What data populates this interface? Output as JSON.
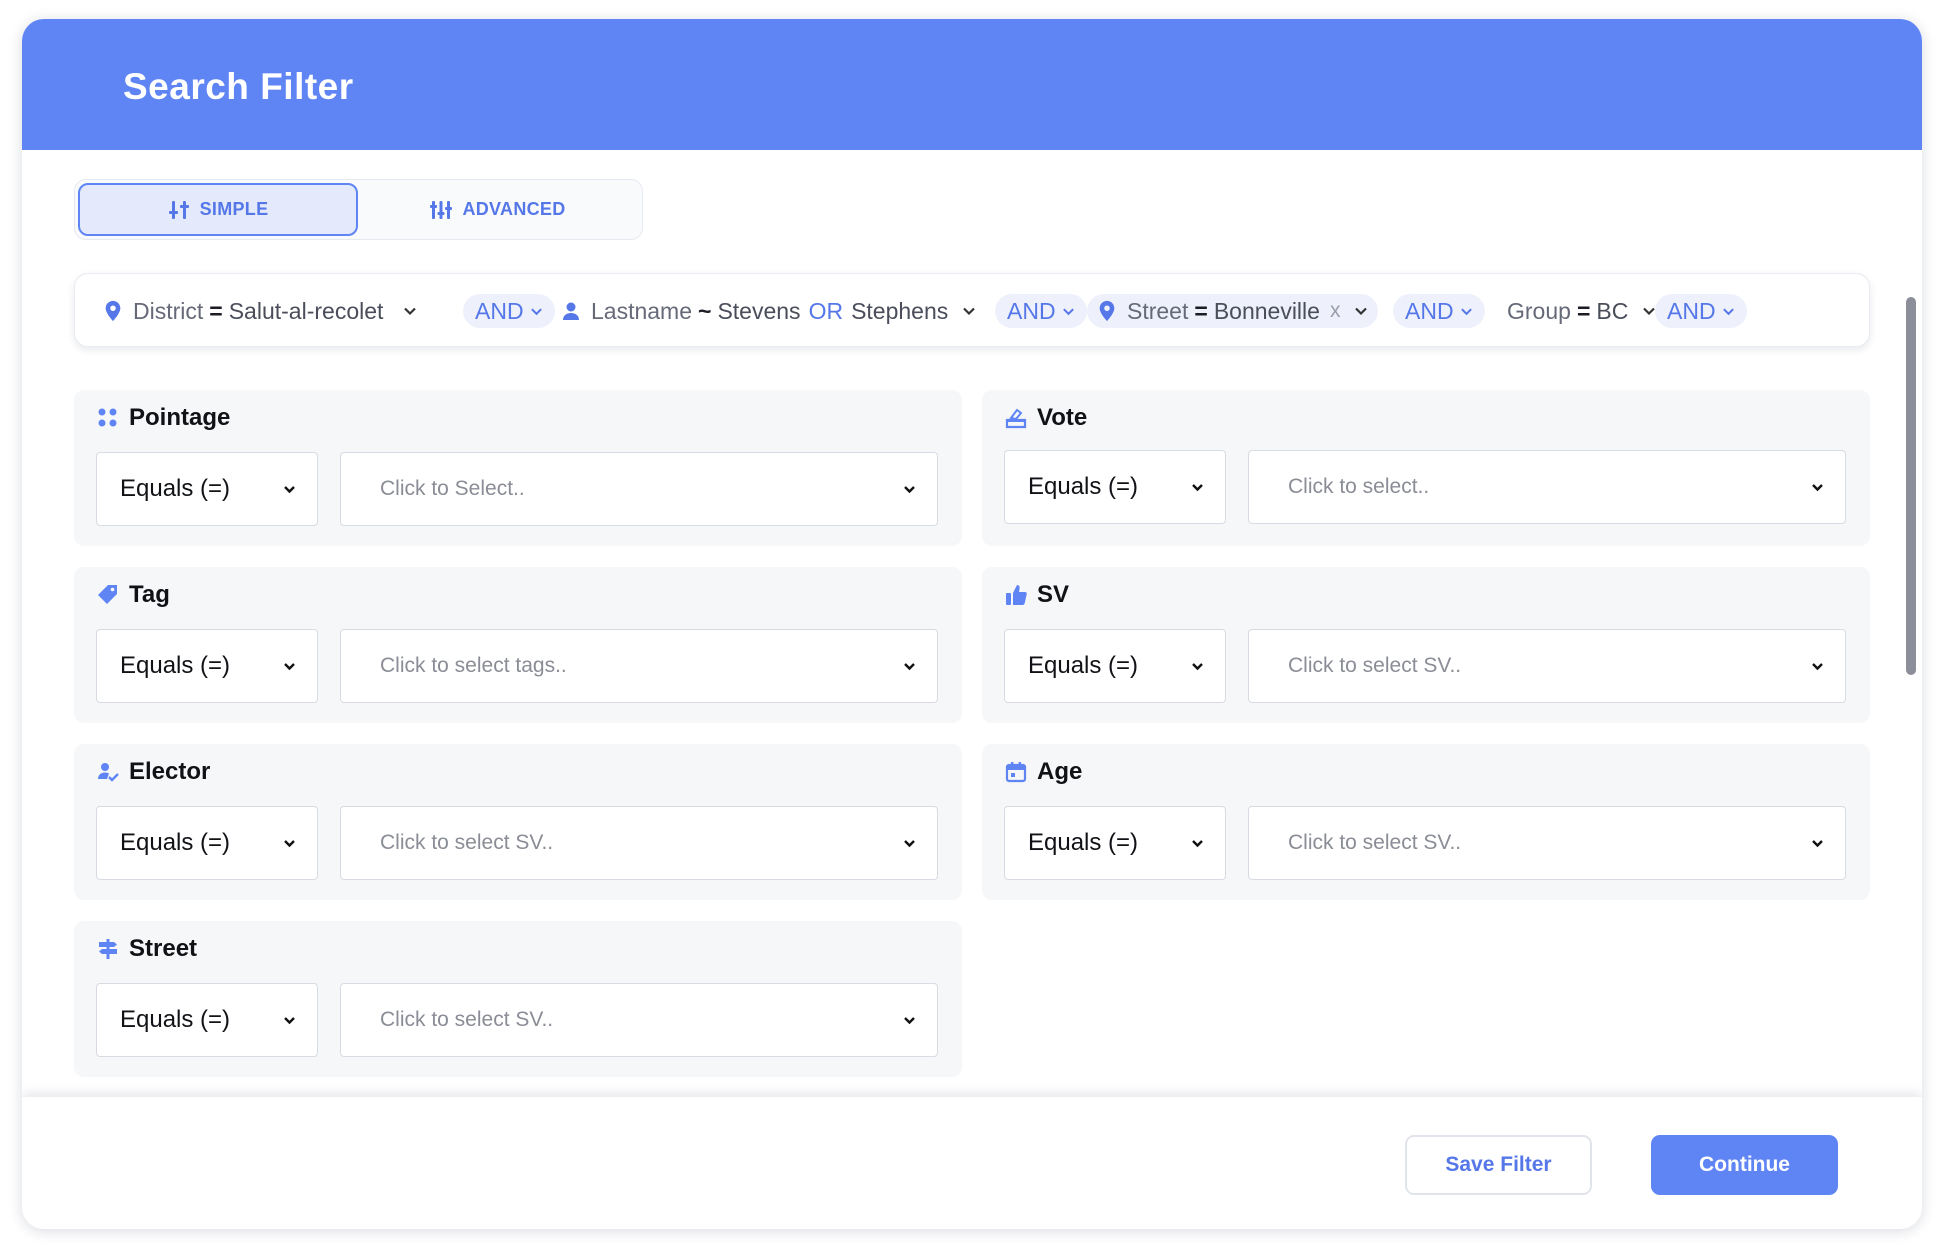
{
  "title": "Search Filter",
  "modes": {
    "simple": "SIMPLE",
    "advanced": "ADVANCED",
    "active": "simple"
  },
  "chips": {
    "district": {
      "key": "District",
      "op": "=",
      "value": "Salut-al-recolet"
    },
    "lastname": {
      "key": "Lastname",
      "op": "~",
      "value1": "Stevens",
      "or": "OR",
      "value2": "Stephens"
    },
    "street": {
      "key": "Street",
      "op": "=",
      "value": "Bonneville",
      "remove": "x"
    },
    "group": {
      "key": "Group",
      "op": "=",
      "value": "BC"
    },
    "and_label": "AND"
  },
  "filters": {
    "pointage": {
      "title": "Pointage",
      "operator": "Equals (=)",
      "placeholder": "Click to Select.."
    },
    "vote": {
      "title": "Vote",
      "operator": "Equals (=)",
      "placeholder": "Click to select.."
    },
    "tag": {
      "title": "Tag",
      "operator": "Equals (=)",
      "placeholder": "Click to select tags.."
    },
    "sv": {
      "title": "SV",
      "operator": "Equals (=)",
      "placeholder": "Click to select SV.."
    },
    "elector": {
      "title": "Elector",
      "operator": "Equals (=)",
      "placeholder": "Click to select SV.."
    },
    "age": {
      "title": "Age",
      "operator": "Equals (=)",
      "placeholder": "Click to select SV.."
    },
    "street": {
      "title": "Street",
      "operator": "Equals (=)",
      "placeholder": "Click to select SV.."
    }
  },
  "footer": {
    "save_label": "Save Filter",
    "continue_label": "Continue"
  },
  "colors": {
    "accent": "#5f85f5",
    "accent_text": "#5577e8",
    "card_bg": "#f6f7f9"
  }
}
